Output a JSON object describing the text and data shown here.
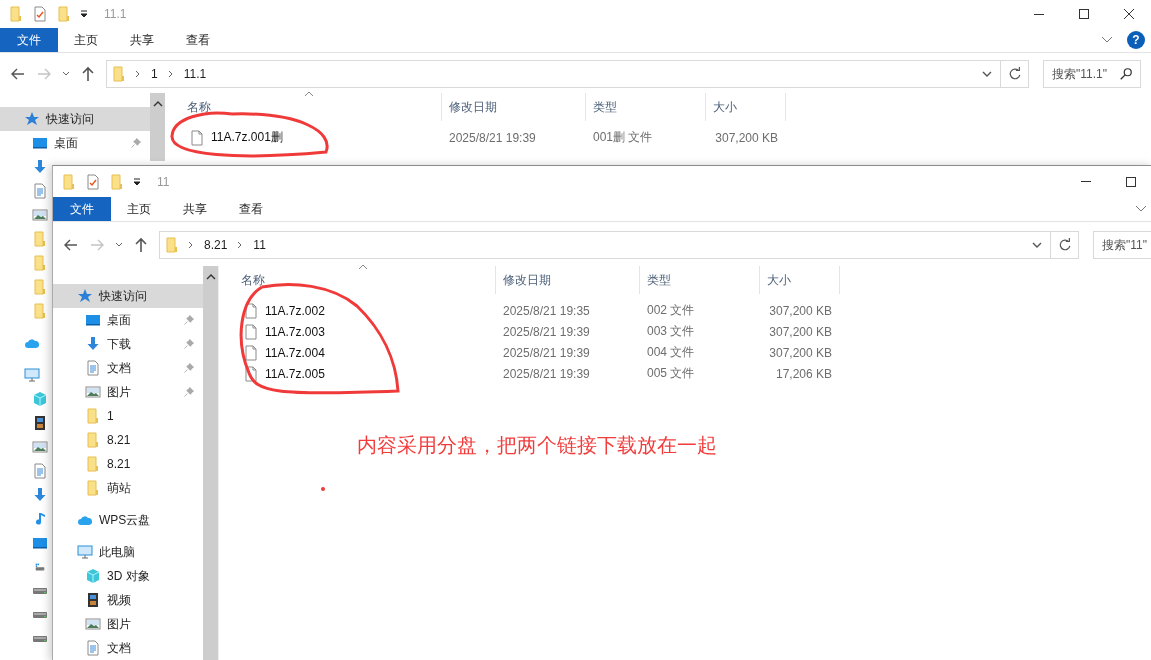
{
  "back_window": {
    "title": "11.1",
    "controls": [
      {
        "kind": "minimize"
      },
      {
        "kind": "maximize"
      },
      {
        "kind": "close"
      }
    ],
    "ribbon_tabs": [
      {
        "label": "文件",
        "kind": "file"
      },
      {
        "label": "主页",
        "kind": "tab"
      },
      {
        "label": "共享",
        "kind": "tab"
      },
      {
        "label": "查看",
        "kind": "tab"
      }
    ],
    "help_button": {
      "label": "?"
    },
    "forward_enabled": false,
    "breadcrumb": [
      "1",
      "11.1"
    ],
    "search": {
      "placeholder": "搜索\"11.1\""
    },
    "sidebar": {
      "items": [
        {
          "kind": "star",
          "label": "快速访问",
          "selected": true,
          "pinned": false,
          "children": [
            {
              "kind": "desktop",
              "label": "桌面",
              "selected": false,
              "pinned": true
            },
            {
              "kind": "download"
            },
            {
              "kind": "document"
            },
            {
              "kind": "picture"
            },
            {
              "kind": "folder"
            },
            {
              "kind": "folder"
            },
            {
              "kind": "folder"
            },
            {
              "kind": "folder"
            }
          ]
        },
        {
          "kind": "cloud"
        },
        {
          "kind": "pc",
          "children": [
            {
              "kind": "cube"
            },
            {
              "kind": "film"
            },
            {
              "kind": "picture"
            },
            {
              "kind": "document"
            },
            {
              "kind": "download"
            },
            {
              "kind": "music"
            },
            {
              "kind": "desktop"
            },
            {
              "kind": "system_drive"
            },
            {
              "kind": "drive"
            },
            {
              "kind": "drive"
            },
            {
              "kind": "drive"
            }
          ]
        }
      ]
    },
    "table": {
      "columns": [
        "名称",
        "修改日期",
        "类型",
        "大小"
      ],
      "rows": [
        {
          "name": "11A.7z.001删",
          "modified": "2025/8/21 19:39",
          "type": "001删 文件",
          "size": "307,200 KB"
        }
      ]
    }
  },
  "front_window": {
    "title": "11",
    "controls": [
      {
        "kind": "minimize"
      },
      {
        "kind": "maximize"
      }
    ],
    "ribbon_tabs": [
      {
        "label": "文件",
        "kind": "file"
      },
      {
        "label": "主页",
        "kind": "tab"
      },
      {
        "label": "共享",
        "kind": "tab"
      },
      {
        "label": "查看",
        "kind": "tab"
      }
    ],
    "forward_enabled": false,
    "breadcrumb": [
      "8.21",
      "11"
    ],
    "search": {
      "placeholder": "搜索\"11\""
    },
    "sidebar": {
      "items": [
        {
          "kind": "star",
          "label": "快速访问",
          "selected": true,
          "pinned": false,
          "children": [
            {
              "kind": "desktop",
              "label": "桌面",
              "selected": false,
              "pinned": true
            },
            {
              "kind": "download",
              "label": "下载",
              "selected": false,
              "pinned": true
            },
            {
              "kind": "document",
              "label": "文档",
              "selected": false,
              "pinned": true
            },
            {
              "kind": "picture",
              "label": "图片",
              "selected": false,
              "pinned": true
            },
            {
              "kind": "folder",
              "label": "1",
              "selected": false,
              "pinned": false
            },
            {
              "kind": "folder",
              "label": "8.21",
              "selected": false,
              "pinned": false
            },
            {
              "kind": "folder",
              "label": "8.21",
              "selected": false,
              "pinned": false
            },
            {
              "kind": "folder",
              "label": "萌站",
              "selected": false,
              "pinned": false
            }
          ]
        },
        {
          "kind": "cloud",
          "label": "WPS云盘",
          "selected": false,
          "pinned": false
        },
        {
          "kind": "pc",
          "label": "此电脑",
          "selected": false,
          "pinned": false,
          "children": [
            {
              "kind": "cube",
              "label": "3D 对象",
              "selected": false,
              "pinned": false
            },
            {
              "kind": "film",
              "label": "视频",
              "selected": false,
              "pinned": false
            },
            {
              "kind": "picture",
              "label": "图片",
              "selected": false,
              "pinned": false
            },
            {
              "kind": "document",
              "label": "文档",
              "selected": false,
              "pinned": false
            }
          ]
        }
      ]
    },
    "table": {
      "columns": [
        "名称",
        "修改日期",
        "类型",
        "大小"
      ],
      "rows": [
        {
          "name": "11A.7z.002",
          "modified": "2025/8/21 19:35",
          "type": "002 文件",
          "size": "307,200 KB"
        },
        {
          "name": "11A.7z.003",
          "modified": "2025/8/21 19:39",
          "type": "003 文件",
          "size": "307,200 KB"
        },
        {
          "name": "11A.7z.004",
          "modified": "2025/8/21 19:39",
          "type": "004 文件",
          "size": "307,200 KB"
        },
        {
          "name": "11A.7z.005",
          "modified": "2025/8/21 19:39",
          "type": "005 文件",
          "size": "17,206 KB"
        }
      ]
    }
  },
  "annotation": {
    "note": "内容采用分盘，把两个链接下载放在一起"
  }
}
